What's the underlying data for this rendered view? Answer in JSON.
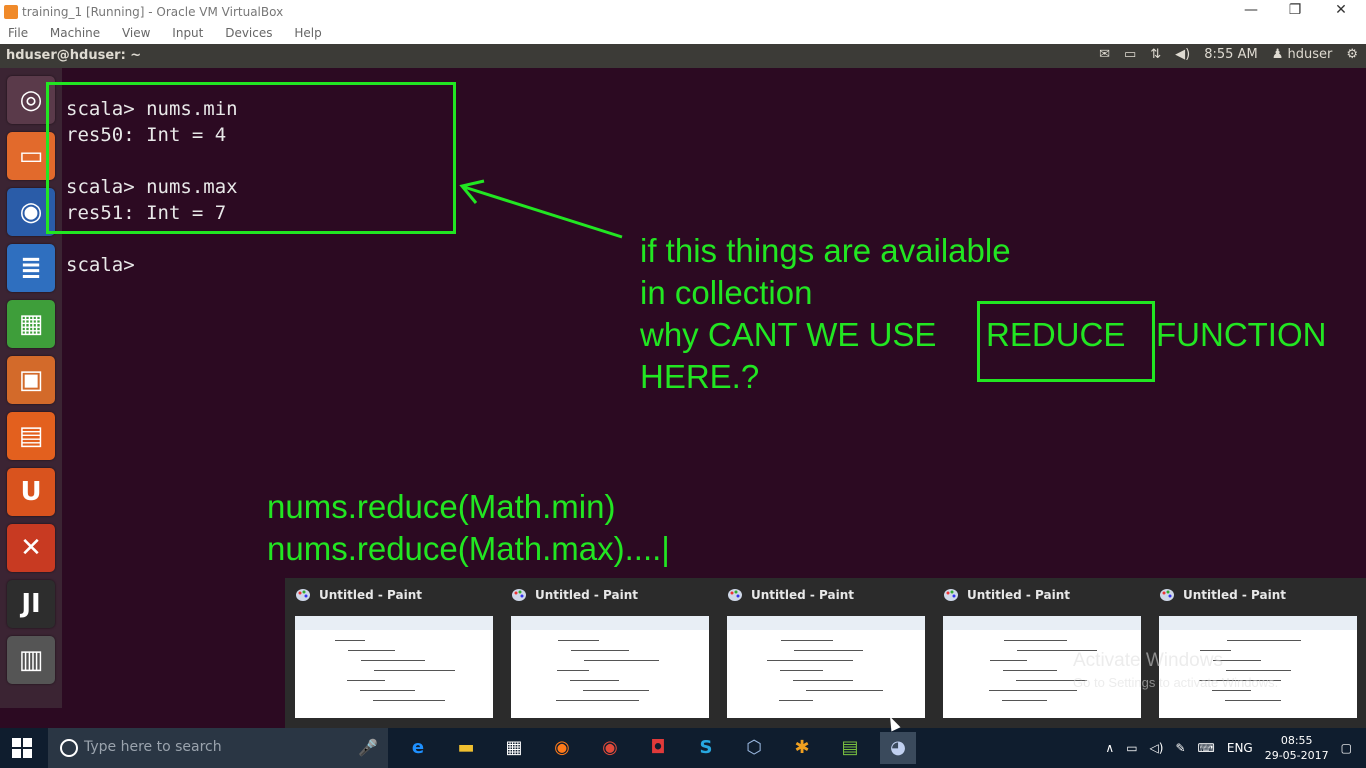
{
  "vbox": {
    "title": "training_1 [Running] - Oracle VM VirtualBox",
    "menu": [
      "File",
      "Machine",
      "View",
      "Input",
      "Devices",
      "Help"
    ],
    "min_icon": "—",
    "restore_icon": "❐",
    "close_icon": "✕"
  },
  "ubuntu_panel": {
    "host": "hduser@hduser: ~",
    "mail_icon": "✉",
    "battery_icon": "▭",
    "network_icon": "⇅",
    "volume_icon": "◀)",
    "time": "8:55 AM",
    "user": "hduser",
    "power_icon": "⚙"
  },
  "launcher": {
    "items": [
      {
        "name": "ubuntu-dash-icon",
        "glyph": "◎",
        "color": "#5a3a4a"
      },
      {
        "name": "files-icon",
        "glyph": "▭",
        "color": "#e26a2c"
      },
      {
        "name": "firefox-icon",
        "glyph": "◉",
        "color": "#2a5ca8"
      },
      {
        "name": "writer-icon",
        "glyph": "≣",
        "color": "#2f6fbf"
      },
      {
        "name": "calc-icon",
        "glyph": "▦",
        "color": "#3e9e3a"
      },
      {
        "name": "impress-icon",
        "glyph": "▣",
        "color": "#d36a2a"
      },
      {
        "name": "software-center-icon",
        "glyph": "▤",
        "color": "#e3601e"
      },
      {
        "name": "ubuntu-one-icon",
        "glyph": "U",
        "color": "#d9531e"
      },
      {
        "name": "system-settings-icon",
        "glyph": "✕",
        "color": "#c83a22"
      },
      {
        "name": "intellij-icon",
        "glyph": "JI",
        "color": "#2d2d2d"
      },
      {
        "name": "trash-icon",
        "glyph": "▥",
        "color": "#555555"
      }
    ]
  },
  "terminal": {
    "text": "scala> nums.min\nres50: Int = 4\n\nscala> nums.max\nres51: Int = 7\n\nscala> "
  },
  "annotations": {
    "question_lines": [
      "if this things are available",
      "in collection",
      "why CANT WE USE",
      "REDUCE",
      "FUNCTION",
      "HERE.?"
    ],
    "code_lines": [
      "nums.reduce(Math.min)",
      "nums.reduce(Math.max)....|"
    ],
    "color": "#22e622"
  },
  "thumbnails": [
    {
      "title": "Untitled - Paint"
    },
    {
      "title": "Untitled - Paint"
    },
    {
      "title": "Untitled - Paint"
    },
    {
      "title": "Untitled - Paint"
    },
    {
      "title": "Untitled - Paint"
    }
  ],
  "watermark": {
    "line1": "Activate Windows",
    "line2": "Go to Settings to activate Windows."
  },
  "taskbar": {
    "search_placeholder": "Type here to search",
    "mic_icon": "🎤",
    "apps": [
      {
        "name": "edge-taskbar-icon",
        "glyph": "e",
        "color": "#1e90ff"
      },
      {
        "name": "file-explorer-taskbar-icon",
        "glyph": "▬",
        "color": "#f0c030"
      },
      {
        "name": "store-taskbar-icon",
        "glyph": "▦",
        "color": "#ffffff"
      },
      {
        "name": "firefox-taskbar-icon",
        "glyph": "◉",
        "color": "#ff7a1a"
      },
      {
        "name": "chrome-taskbar-icon",
        "glyph": "◉",
        "color": "#e04a3a"
      },
      {
        "name": "snagit-taskbar-icon",
        "glyph": "◘",
        "color": "#e03a3a"
      },
      {
        "name": "skype-taskbar-icon",
        "glyph": "S",
        "color": "#28a8e0"
      },
      {
        "name": "virtualbox-taskbar-icon",
        "glyph": "⬡",
        "color": "#9ab8e0"
      },
      {
        "name": "flower-taskbar-icon",
        "glyph": "✱",
        "color": "#f0a020"
      },
      {
        "name": "notepad-taskbar-icon",
        "glyph": "▤",
        "color": "#7ac040"
      },
      {
        "name": "paint-taskbar-icon",
        "glyph": "◕",
        "color": "#c0d0f0"
      }
    ],
    "tray_up": "∧",
    "tray_network": "▭",
    "tray_volume": "◁)",
    "tray_pen": "✎",
    "tray_keyboard": "⌨",
    "lang": "ENG",
    "time": "08:55",
    "date": "29-05-2017",
    "notifications_icon": "▢"
  }
}
